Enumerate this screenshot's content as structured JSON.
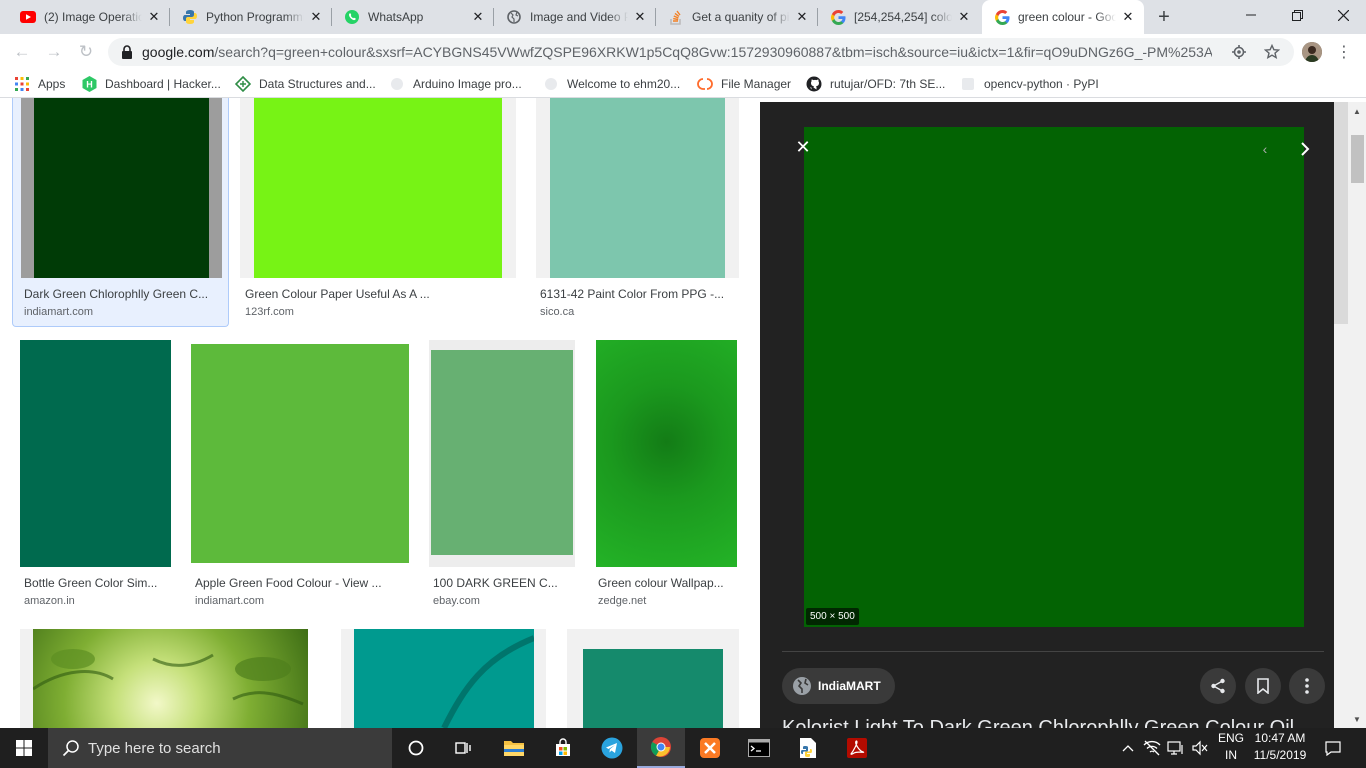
{
  "browser": {
    "tabs": [
      {
        "title": "(2) Image Operatio",
        "icon": "youtube-icon"
      },
      {
        "title": "Python Programmi",
        "icon": "python-icon"
      },
      {
        "title": "WhatsApp",
        "icon": "whatsapp-icon"
      },
      {
        "title": "Image and Video P",
        "icon": "globe-icon"
      },
      {
        "title": "Get a quanity of pi",
        "icon": "stackoverflow-icon"
      },
      {
        "title": "[254,254,254] colo",
        "icon": "google-icon"
      },
      {
        "title": "green colour - Goo",
        "icon": "google-icon",
        "active": true
      }
    ],
    "url_domain": "google.com",
    "url_rest": "/search?q=green+colour&sxsrf=ACYBGNS45VWwfZQSPE96XRKW1p5CqQ8Gvw:1572930960887&tbm=isch&source=iu&ictx=1&fir=qO9uDNGz6G_-PM%253A...",
    "bookmarks": [
      {
        "label": "Apps",
        "icon": "apps-grid-icon"
      },
      {
        "label": "Dashboard | Hacker...",
        "icon": "hackerrank-icon"
      },
      {
        "label": "Data Structures and...",
        "icon": "geeks-icon"
      },
      {
        "label": "Arduino Image pro...",
        "icon": "globe-icon"
      },
      {
        "label": "Welcome to ehm20...",
        "icon": "globe-icon"
      },
      {
        "label": "File Manager",
        "icon": "cpanel-icon"
      },
      {
        "label": "rutujar/OFD: 7th SE...",
        "icon": "github-icon"
      },
      {
        "label": "opencv-python · PyPI",
        "icon": "pypi-icon"
      }
    ]
  },
  "results": [
    {
      "caption": "Dark Green Chlorophlly Green C...",
      "source": "indiamart.com",
      "color": "#003b06",
      "selected": true
    },
    {
      "caption": "Green Colour Paper Useful As A ...",
      "source": "123rf.com",
      "color": "#77f315"
    },
    {
      "caption": "6131-42 Paint Color From PPG -...",
      "source": "sico.ca",
      "color": "#7dc6ad"
    },
    {
      "caption": "Bottle Green Color Sim...",
      "source": "amazon.in",
      "color": "#006a4e"
    },
    {
      "caption": "Apple Green Food Colour - View ...",
      "source": "indiamart.com",
      "color": "#5dba3b"
    },
    {
      "caption": "100 DARK GREEN C...",
      "source": "ebay.com",
      "color": "#67b072"
    },
    {
      "caption": "Green colour Wallpap...",
      "source": "zedge.net",
      "color": "#1b991e"
    },
    {
      "caption": "",
      "source": "",
      "color": "#8cc34a"
    },
    {
      "caption": "",
      "source": "",
      "color": "#009a8f"
    },
    {
      "caption": "",
      "source": "",
      "color": "#158a6c"
    }
  ],
  "preview": {
    "dimensions": "500 × 500",
    "color": "#036303",
    "site": "IndiaMART",
    "title": "Kolorist Light To Dark Green Chlorophlly Green Colour Oil"
  },
  "taskbar": {
    "search_placeholder": "Type here to search",
    "lang_line1": "ENG",
    "lang_line2": "IN",
    "time": "10:47 AM",
    "date": "11/5/2019"
  }
}
